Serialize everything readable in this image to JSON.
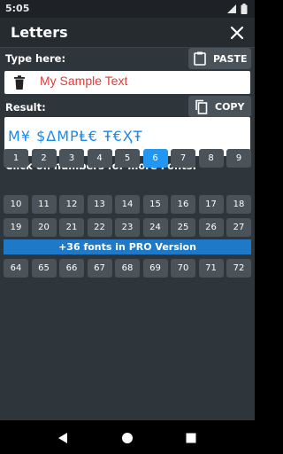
{
  "status_bar": {
    "time": "5:05"
  },
  "app_bar": {
    "title": "Letters"
  },
  "input_section": {
    "label": "Type here:",
    "paste_label": "PASTE",
    "value": "My Sample Text"
  },
  "result_section": {
    "label": "Result:",
    "copy_label": "COPY",
    "value": "M¥ $ΔMPⱠ€ Ŧ€ҲŦ"
  },
  "fonts_section": {
    "label": "Click on numbers for more Fonts:",
    "selected": "6",
    "row1": [
      "1",
      "2",
      "3",
      "4",
      "5",
      "6",
      "7",
      "8",
      "9"
    ],
    "row2": [
      "10",
      "11",
      "12",
      "13",
      "14",
      "15",
      "16",
      "17",
      "18"
    ],
    "row3": [
      "19",
      "20",
      "21",
      "22",
      "23",
      "24",
      "25",
      "26",
      "27"
    ],
    "pro_banner": "+36 fonts in PRO Version",
    "row4": [
      "64",
      "65",
      "66",
      "67",
      "68",
      "69",
      "70",
      "71",
      "72"
    ]
  },
  "colors": {
    "background": "#2e353b",
    "button": "#4a525a",
    "accent": "#2196f3",
    "input_text": "#e53935",
    "result_text": "#1e88e5",
    "pro_banner": "#1e7ac8"
  },
  "icons": [
    "wifi-icon",
    "battery-icon",
    "close-icon",
    "paste-icon",
    "trash-icon",
    "copy-icon",
    "back-icon",
    "home-icon",
    "recents-icon"
  ]
}
